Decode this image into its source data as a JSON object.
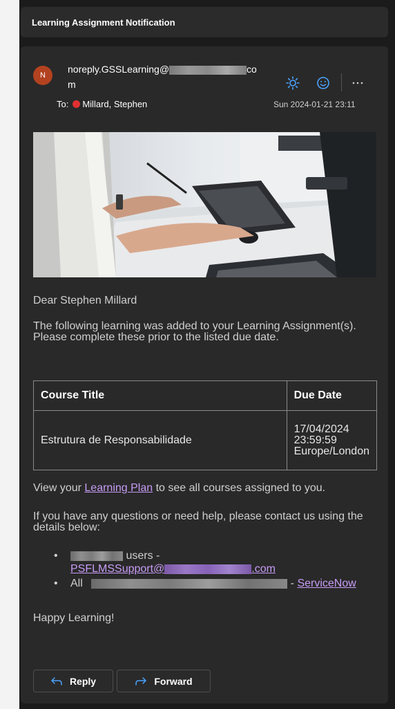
{
  "email": {
    "subject": "Learning Assignment Notification",
    "avatar_initial": "N",
    "sender_prefix": "noreply.GSSLearning@",
    "sender_suffix_line1": "co",
    "sender_suffix_line2": "m",
    "to_label": "To:",
    "recipient": "Millard, Stephen",
    "date": "Sun 2024-01-21 23:11",
    "header_icons": [
      "sun-icon",
      "smiley-icon",
      "more-icon"
    ]
  },
  "body": {
    "greeting": "Dear Stephen Millard",
    "intro": "The following learning was added to your Learning Assignment(s). Please complete these prior to the listed due date.",
    "table": {
      "headers": [
        "Course Title",
        "Due Date"
      ],
      "rows": [
        {
          "course": "Estrutura de Responsabilidade",
          "due_line1": "17/04/2024",
          "due_line2": "23:59:59",
          "due_line3": "Europe/London"
        }
      ]
    },
    "view_prefix": "View your ",
    "view_link": "Learning Plan",
    "view_suffix": " to see all courses assigned to you.",
    "help_text": "If you have any questions or need help, please contact us using the details below:",
    "bullets": [
      {
        "visible_text": "users -",
        "link_prefix": "PSFLMSSupport@",
        "link_suffix": ".com"
      },
      {
        "prefix": "All",
        "separator": " - ",
        "link": "ServiceNow"
      }
    ],
    "closing": "Happy Learning!"
  },
  "actions": {
    "reply_label": "Reply",
    "forward_label": "Forward"
  },
  "colors": {
    "background": "#1b1b1b",
    "card": "#292929",
    "link": "#c79cf6",
    "accent_icon": "#4aa3ff",
    "presence": "#e03131",
    "avatar": "#b34220"
  }
}
